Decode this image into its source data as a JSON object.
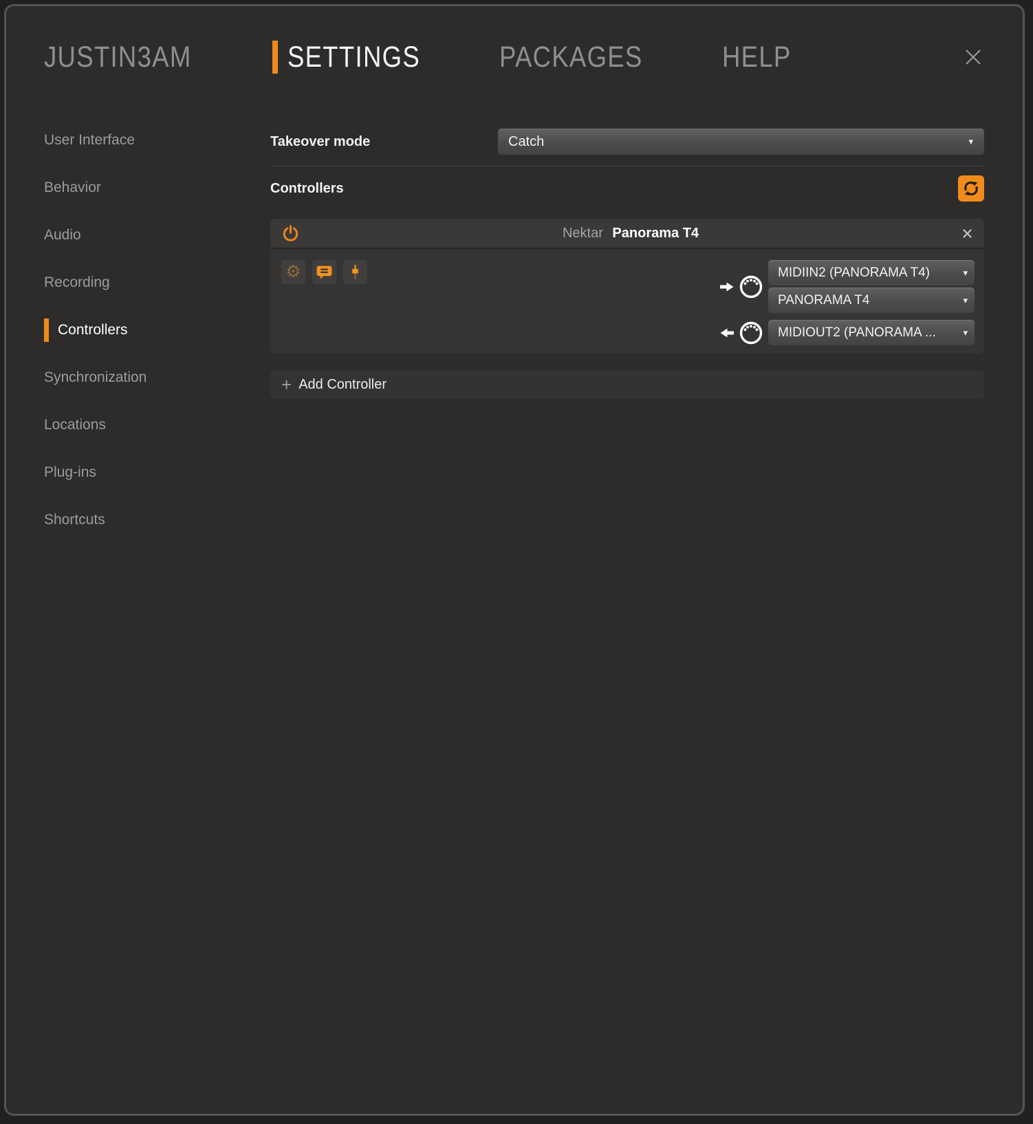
{
  "nav": {
    "brand": "JUSTIN3AM",
    "tabs": [
      {
        "label": "SETTINGS",
        "active": true
      },
      {
        "label": "PACKAGES",
        "active": false
      },
      {
        "label": "HELP",
        "active": false
      }
    ]
  },
  "sidebar": {
    "items": [
      {
        "label": "User Interface",
        "active": false
      },
      {
        "label": "Behavior",
        "active": false
      },
      {
        "label": "Audio",
        "active": false
      },
      {
        "label": "Recording",
        "active": false
      },
      {
        "label": "Controllers",
        "active": true
      },
      {
        "label": "Synchronization",
        "active": false
      },
      {
        "label": "Locations",
        "active": false
      },
      {
        "label": "Plug-ins",
        "active": false
      },
      {
        "label": "Shortcuts",
        "active": false
      }
    ]
  },
  "settings": {
    "takeover": {
      "label": "Takeover mode",
      "value": "Catch"
    },
    "controllers_heading": "Controllers",
    "controller_card": {
      "vendor": "Nektar",
      "model": "Panorama T4",
      "midi_in_ports": [
        "MIDIIN2 (PANORAMA T4)",
        "PANORAMA T4"
      ],
      "midi_out_ports": [
        "MIDIOUT2 (PANORAMA ..."
      ]
    },
    "add_controller": {
      "plus": "+",
      "label": "Add Controller"
    }
  },
  "icons": {
    "gear": "⚙",
    "caret": "▾"
  },
  "colors": {
    "accent_orange": "#ef8a1a",
    "refresh_orange": "#f18c1c",
    "dialog_bg": "#2e2b2b",
    "card_header_bg": "#3b3838",
    "card_body_bg": "#363333",
    "dropdown_top": "#616161",
    "dropdown_bottom": "#444343",
    "text_dim": "#9c9c9c",
    "text_bright": "#f4f4f4"
  }
}
